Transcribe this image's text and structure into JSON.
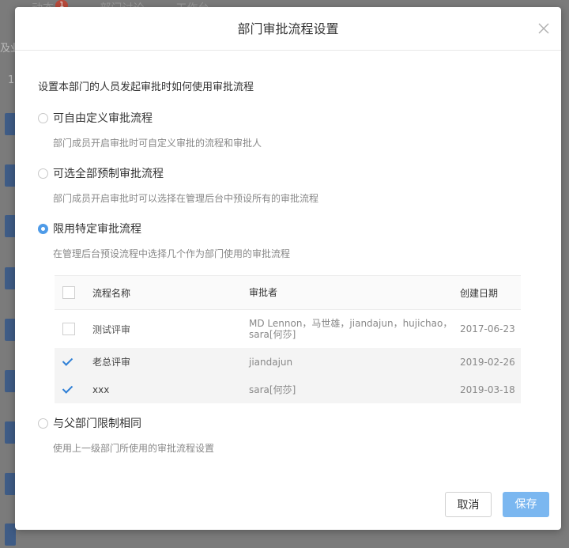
{
  "background": {
    "tabs": [
      "动态",
      "部门讨论",
      "工作台"
    ],
    "badge": "1",
    "left_texts": [
      "及业",
      "1"
    ]
  },
  "modal": {
    "title": "部门审批流程设置",
    "intro": "设置本部门的人员发起审批时如何使用审批流程",
    "options": [
      {
        "label": "可自由定义审批流程",
        "desc": "部门成员开启审批时可自定义审批的流程和审批人",
        "checked": false
      },
      {
        "label": "可选全部预制审批流程",
        "desc": "部门成员开启审批时可以选择在管理后台中预设所有的审批流程",
        "checked": false
      },
      {
        "label": "限用特定审批流程",
        "desc": "在管理后台预设流程中选择几个作为部门使用的审批流程",
        "checked": true
      },
      {
        "label": "与父部门限制相同",
        "desc": "使用上一级部门所使用的审批流程设置",
        "checked": false
      }
    ],
    "table": {
      "headers": {
        "name": "流程名称",
        "approver": "审批者",
        "date": "创建日期"
      },
      "rows": [
        {
          "name": "测试评审",
          "approver": "MD Lennon，马世雄，jiandajun，hujichao，sara[何莎]",
          "date": "2017-06-23",
          "checked": false
        },
        {
          "name": "老总评审",
          "approver": "jiandajun",
          "date": "2019-02-26",
          "checked": true
        },
        {
          "name": "xxx",
          "approver": "sara[何莎]",
          "date": "2019-03-18",
          "checked": true
        }
      ]
    },
    "buttons": {
      "cancel": "取消",
      "save": "保存"
    }
  },
  "colors": {
    "accent": "#4e9be8",
    "save_button": "#7bb7f0",
    "checkmark": "#2e7fd6"
  }
}
